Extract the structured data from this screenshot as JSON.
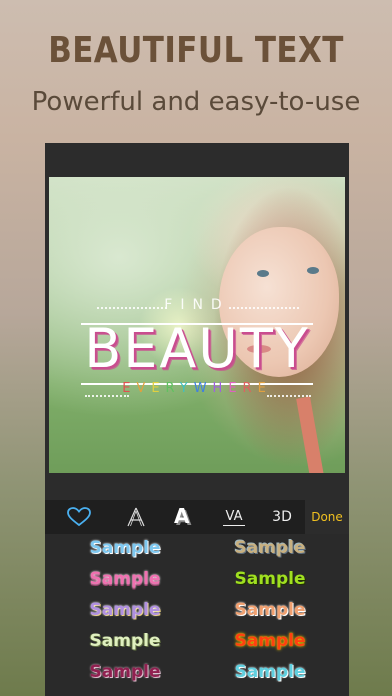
{
  "hero": {
    "title": "BEAUTIFUL TEXT",
    "subtitle": "Powerful and easy-to-use"
  },
  "canvas": {
    "line1": "FIND",
    "line2": "BEAUTY",
    "line3": "EVERYWHERE"
  },
  "toolbar": {
    "tools": [
      {
        "name": "heart-icon",
        "glyph": "♡"
      },
      {
        "name": "outline-font-icon",
        "glyph": "A"
      },
      {
        "name": "shadow-font-icon",
        "glyph": "A"
      },
      {
        "name": "spacing-icon",
        "glyph": "VA"
      },
      {
        "name": "3d-icon",
        "glyph": "3D"
      }
    ],
    "done_label": "Done"
  },
  "samples": {
    "label": "Sample",
    "styles": [
      {
        "fill": "#7ec8f0",
        "stroke": "#ffffff"
      },
      {
        "fill": "#c8b080",
        "stroke": "#607080"
      },
      {
        "fill": "#f070b0",
        "stroke": "#ffffff"
      },
      {
        "fill": "#a0e020",
        "stroke": "#203000"
      },
      {
        "fill": "#b090e0",
        "stroke": "#ffffff"
      },
      {
        "fill": "#f0a070",
        "stroke": "#ffffff"
      },
      {
        "fill": "#e0f0c0",
        "stroke": "#607040"
      },
      {
        "fill": "#ff4010",
        "stroke": "#ffd000"
      },
      {
        "fill": "#902050",
        "stroke": "#e0c0d0"
      },
      {
        "fill": "#60d0e0",
        "stroke": "#ffffff"
      }
    ]
  }
}
